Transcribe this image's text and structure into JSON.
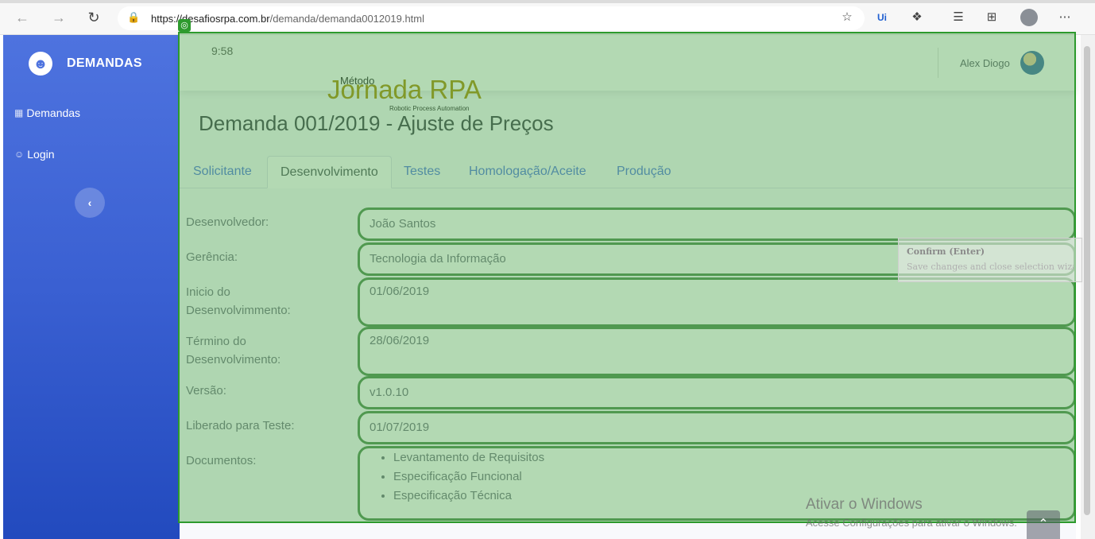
{
  "browser": {
    "url_host": "https://desafiosrpa.com.br",
    "url_path": "/demanda/demanda0012019.html",
    "icons": [
      "back-icon",
      "forward-icon",
      "refresh-icon",
      "lock-icon",
      "favorite-add-icon",
      "uipath-extension-icon",
      "extensions-icon",
      "favorites-icon",
      "collections-icon",
      "profile-icon",
      "more-icon"
    ]
  },
  "sidebar": {
    "brand": "DEMANDAS",
    "items": [
      {
        "label": "Demandas",
        "icon": "table-icon"
      },
      {
        "label": "Login",
        "icon": "user-circle-icon"
      }
    ],
    "toggle_icon": "‹"
  },
  "topbar": {
    "time": "9:58",
    "user_name": "Alex Diogo"
  },
  "logo": {
    "metodo": "Método",
    "name": "Jornada RPA",
    "subtitle": "Robotic Process Automation"
  },
  "page": {
    "title": "Demanda 001/2019 - Ajuste de Preços"
  },
  "tabs": [
    {
      "label": "Solicitante",
      "active": false
    },
    {
      "label": "Desenvolvimento",
      "active": true
    },
    {
      "label": "Testes",
      "active": false
    },
    {
      "label": "Homologação/Aceite",
      "active": false
    },
    {
      "label": "Produção",
      "active": false
    }
  ],
  "form": {
    "desenvolvedor": {
      "label": "Desenvolvedor:",
      "value": "João Santos"
    },
    "gerencia": {
      "label": "Gerência:",
      "value": "Tecnologia da Informação"
    },
    "inicio": {
      "label_line1": "Inicio do",
      "label_line2": "Desenvolvimmento:",
      "value": "01/06/2019"
    },
    "termino": {
      "label_line1": "Término do",
      "label_line2": "Desenvolvimento:",
      "value": "28/06/2019"
    },
    "versao": {
      "label": "Versão:",
      "value": "v1.0.10"
    },
    "liberado": {
      "label": "Liberado para Teste:",
      "value": "01/07/2019"
    },
    "documentos": {
      "label": "Documentos:",
      "items": [
        "Levantamento de Requisitos",
        "Especificação Funcional",
        "Especificação Técnica"
      ]
    }
  },
  "wizard": {
    "confirm_title": "Confirm (Enter)",
    "confirm_desc": "Save changes and close selection wizard"
  },
  "watermark": {
    "line1": "Ativar o Windows",
    "line2": "Acesse Configurações para ativar o Windows."
  }
}
